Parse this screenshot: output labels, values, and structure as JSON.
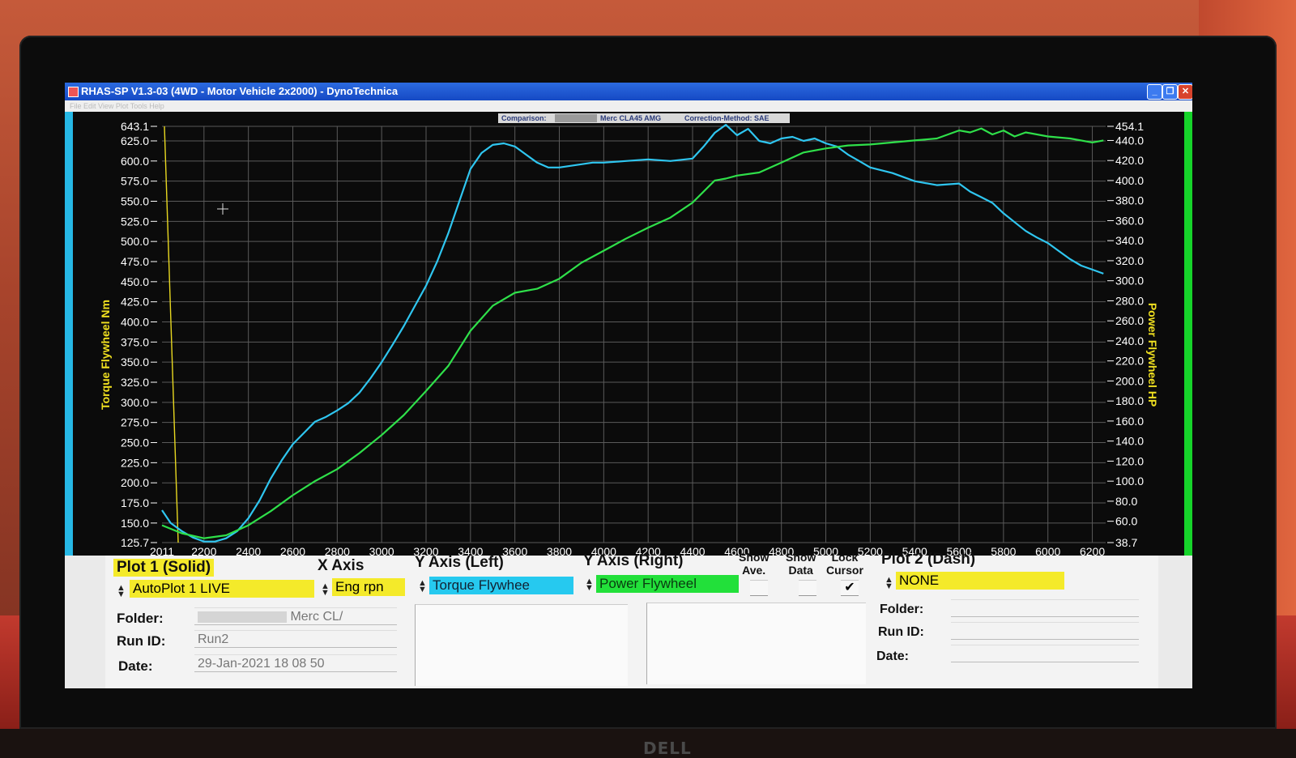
{
  "window": {
    "title": "RHAS-SP V1.3-03  (4WD - Motor Vehicle 2x2000) - DynoTechnica",
    "menu": "File  Edit  View  Plot  Tools  Help"
  },
  "comparison_bar": {
    "comparison_label": "Comparison:",
    "vehicle": "Merc CLA45 AMG",
    "correction": "Correction-Method: SAE"
  },
  "chart_data": {
    "type": "line",
    "xlabel": "",
    "ylabel_left": "Torque Flywheel Nm",
    "ylabel_right": "Power Flywheel HP",
    "xlim": [
      2011,
      6260
    ],
    "x_ticks": [
      "2011",
      "2200",
      "2400",
      "2600",
      "2800",
      "3000",
      "3200",
      "3400",
      "3600",
      "3800",
      "4000",
      "4200",
      "4400",
      "4600",
      "4800",
      "5000",
      "5200",
      "5400",
      "5600",
      "5800",
      "6000",
      "6200"
    ],
    "y_left_ticks": [
      "643.1",
      "625.0",
      "600.0",
      "575.0",
      "550.0",
      "525.0",
      "500.0",
      "475.0",
      "450.0",
      "425.0",
      "400.0",
      "375.0",
      "350.0",
      "325.0",
      "300.0",
      "275.0",
      "250.0",
      "225.0",
      "200.0",
      "175.0",
      "150.0",
      "125.7"
    ],
    "y_right_ticks": [
      "454.1",
      "440.0",
      "420.0",
      "400.0",
      "380.0",
      "360.0",
      "340.0",
      "320.0",
      "300.0",
      "280.0",
      "260.0",
      "240.0",
      "220.0",
      "200.0",
      "180.0",
      "160.0",
      "140.0",
      "120.0",
      "100.0",
      "80.0",
      "60.0",
      "38.7"
    ],
    "ylim_left": [
      125.7,
      643.1
    ],
    "ylim_right": [
      38.7,
      454.1
    ],
    "grid": true,
    "series": [
      {
        "name": "Torque Flywhee",
        "axis": "left",
        "color": "#2fc6f0",
        "x": [
          2011,
          2050,
          2100,
          2150,
          2200,
          2250,
          2300,
          2350,
          2400,
          2450,
          2500,
          2550,
          2600,
          2650,
          2700,
          2750,
          2800,
          2850,
          2900,
          2950,
          3000,
          3050,
          3100,
          3150,
          3200,
          3250,
          3300,
          3350,
          3400,
          3450,
          3500,
          3550,
          3600,
          3650,
          3700,
          3750,
          3800,
          3850,
          3900,
          3950,
          4000,
          4100,
          4200,
          4300,
          4400,
          4450,
          4500,
          4550,
          4600,
          4650,
          4700,
          4750,
          4800,
          4850,
          4900,
          4950,
          5000,
          5050,
          5100,
          5150,
          5200,
          5300,
          5400,
          5500,
          5600,
          5650,
          5700,
          5750,
          5800,
          5850,
          5900,
          5950,
          6000,
          6050,
          6100,
          6150,
          6200,
          6250
        ],
        "y": [
          166,
          150,
          140,
          132,
          127,
          127,
          131,
          140,
          156,
          178,
          205,
          228,
          248,
          262,
          276,
          282,
          290,
          299,
          312,
          330,
          350,
          372,
          395,
          420,
          445,
          475,
          510,
          550,
          590,
          610,
          620,
          622,
          618,
          608,
          598,
          592,
          592,
          594,
          596,
          598,
          598,
          600,
          602,
          600,
          603,
          618,
          635,
          645,
          632,
          640,
          625,
          622,
          628,
          630,
          625,
          628,
          622,
          618,
          608,
          600,
          592,
          585,
          575,
          570,
          572,
          562,
          555,
          548,
          535,
          524,
          513,
          505,
          498,
          488,
          478,
          470,
          465,
          460
        ],
        "values": "see x/y"
      },
      {
        "name": "Power Flywheel",
        "axis": "right",
        "color": "#2fe04a",
        "x": [
          2011,
          2100,
          2200,
          2300,
          2400,
          2500,
          2600,
          2700,
          2800,
          2900,
          3000,
          3100,
          3200,
          3300,
          3400,
          3500,
          3600,
          3700,
          3800,
          3900,
          4000,
          4100,
          4200,
          4300,
          4400,
          4500,
          4550,
          4600,
          4700,
          4800,
          4900,
          5000,
          5100,
          5200,
          5300,
          5400,
          5500,
          5600,
          5650,
          5700,
          5750,
          5800,
          5850,
          5900,
          6000,
          6100,
          6200,
          6250
        ],
        "y": [
          56,
          48,
          43,
          46,
          56,
          70,
          86,
          100,
          112,
          128,
          146,
          166,
          190,
          215,
          250,
          275,
          288,
          292,
          302,
          318,
          330,
          342,
          353,
          363,
          378,
          400,
          402,
          405,
          408,
          418,
          428,
          432,
          435,
          436,
          438,
          440,
          442,
          450,
          448,
          452,
          446,
          450,
          444,
          448,
          444,
          442,
          438,
          440
        ],
        "values": "see x/y"
      }
    ]
  },
  "plot1": {
    "heading": "Plot 1 (Solid)",
    "selection": "AutoPlot 1 LIVE",
    "folder_label": "Folder:",
    "folder_value": "Merc CL/",
    "runid_label": "Run ID:",
    "runid_value": "Run2",
    "date_label": "Date:",
    "date_value": "29-Jan-2021  18 08 50"
  },
  "xaxis": {
    "heading": "X Axis",
    "selection": "Eng rpn"
  },
  "yaxis_left": {
    "heading": "Y Axis (Left)",
    "selection": "Torque Flywhee"
  },
  "yaxis_right": {
    "heading": "Y Axis (Right)",
    "selection": "Power Flywheel"
  },
  "options": {
    "show_ave_l1": "Show",
    "show_ave_l2": "Ave.",
    "show_data_l1": "Show",
    "show_data_l2": "Data",
    "lock_cursor_l1": "Lock",
    "lock_cursor_l2": "Cursor",
    "lock_checkmark": "✔"
  },
  "plot2": {
    "heading": "Plot 2 (Dash)",
    "selection": "NONE",
    "folder_label": "Folder:",
    "runid_label": "Run ID:",
    "date_label": "Date:"
  },
  "monitor": {
    "brand": "DELL"
  }
}
